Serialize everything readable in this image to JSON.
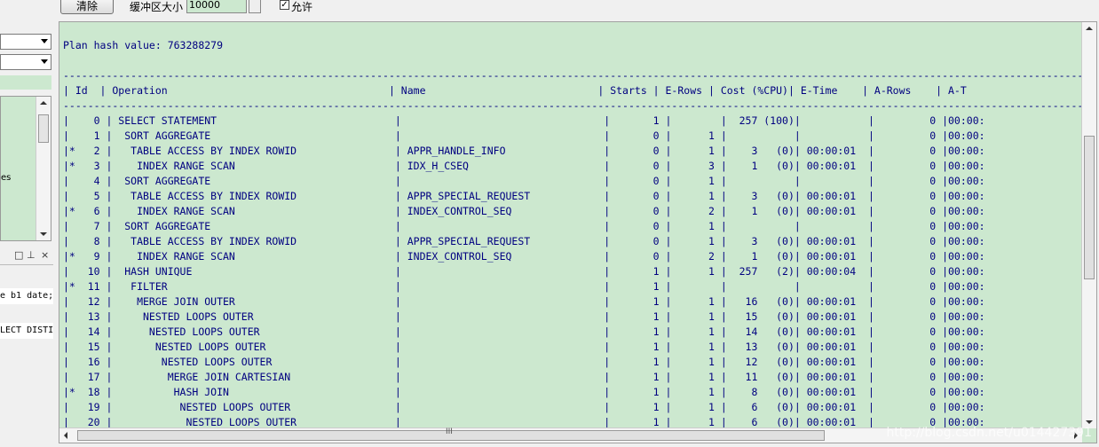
{
  "toolbar": {
    "clear_label": "清除",
    "buffer_label": "缓冲区大小",
    "buffer_value": "10000",
    "allow_checked": true,
    "allow_label": "允许"
  },
  "left_pane": {
    "tree_text": "es",
    "code_line_1": "e b1 date;",
    "code_line_2": "LECT DISTI"
  },
  "output": {
    "plan_header": "Plan hash value: 763288279",
    "columns": [
      "Id",
      "Operation",
      "Name",
      "Starts",
      "E-Rows",
      "Cost (%CPU)",
      "E-Time",
      "A-Rows",
      "A-T"
    ],
    "rows": [
      {
        "flag": "",
        "id": "0",
        "op": "SELECT STATEMENT",
        "name": "",
        "starts": "1",
        "erows": "",
        "cost": "257 (100)",
        "etime": "",
        "arows": "0",
        "atime": "00:00:"
      },
      {
        "flag": "",
        "id": "1",
        "op": " SORT AGGREGATE",
        "name": "",
        "starts": "0",
        "erows": "1",
        "cost": "",
        "etime": "",
        "arows": "0",
        "atime": "00:00:"
      },
      {
        "flag": "*",
        "id": "2",
        "op": "  TABLE ACCESS BY INDEX ROWID",
        "name": "APPR_HANDLE_INFO",
        "starts": "0",
        "erows": "1",
        "cost": "3   (0)",
        "etime": "00:00:01",
        "arows": "0",
        "atime": "00:00:"
      },
      {
        "flag": "*",
        "id": "3",
        "op": "   INDEX RANGE SCAN",
        "name": "IDX_H_CSEQ",
        "starts": "0",
        "erows": "3",
        "cost": "1   (0)",
        "etime": "00:00:01",
        "arows": "0",
        "atime": "00:00:"
      },
      {
        "flag": "",
        "id": "4",
        "op": " SORT AGGREGATE",
        "name": "",
        "starts": "0",
        "erows": "1",
        "cost": "",
        "etime": "",
        "arows": "0",
        "atime": "00:00:"
      },
      {
        "flag": "",
        "id": "5",
        "op": "  TABLE ACCESS BY INDEX ROWID",
        "name": "APPR_SPECIAL_REQUEST",
        "starts": "0",
        "erows": "1",
        "cost": "3   (0)",
        "etime": "00:00:01",
        "arows": "0",
        "atime": "00:00:"
      },
      {
        "flag": "*",
        "id": "6",
        "op": "   INDEX RANGE SCAN",
        "name": "INDEX_CONTROL_SEQ",
        "starts": "0",
        "erows": "2",
        "cost": "1   (0)",
        "etime": "00:00:01",
        "arows": "0",
        "atime": "00:00:"
      },
      {
        "flag": "",
        "id": "7",
        "op": " SORT AGGREGATE",
        "name": "",
        "starts": "0",
        "erows": "1",
        "cost": "",
        "etime": "",
        "arows": "0",
        "atime": "00:00:"
      },
      {
        "flag": "",
        "id": "8",
        "op": "  TABLE ACCESS BY INDEX ROWID",
        "name": "APPR_SPECIAL_REQUEST",
        "starts": "0",
        "erows": "1",
        "cost": "3   (0)",
        "etime": "00:00:01",
        "arows": "0",
        "atime": "00:00:"
      },
      {
        "flag": "*",
        "id": "9",
        "op": "   INDEX RANGE SCAN",
        "name": "INDEX_CONTROL_SEQ",
        "starts": "0",
        "erows": "2",
        "cost": "1   (0)",
        "etime": "00:00:01",
        "arows": "0",
        "atime": "00:00:"
      },
      {
        "flag": "",
        "id": "10",
        "op": " HASH UNIQUE",
        "name": "",
        "starts": "1",
        "erows": "1",
        "cost": "257   (2)",
        "etime": "00:00:04",
        "arows": "0",
        "atime": "00:00:"
      },
      {
        "flag": "*",
        "id": "11",
        "op": "  FILTER",
        "name": "",
        "starts": "1",
        "erows": "",
        "cost": "",
        "etime": "",
        "arows": "0",
        "atime": "00:00:"
      },
      {
        "flag": "",
        "id": "12",
        "op": "   MERGE JOIN OUTER",
        "name": "",
        "starts": "1",
        "erows": "1",
        "cost": "16   (0)",
        "etime": "00:00:01",
        "arows": "0",
        "atime": "00:00:"
      },
      {
        "flag": "",
        "id": "13",
        "op": "    NESTED LOOPS OUTER",
        "name": "",
        "starts": "1",
        "erows": "1",
        "cost": "15   (0)",
        "etime": "00:00:01",
        "arows": "0",
        "atime": "00:00:"
      },
      {
        "flag": "",
        "id": "14",
        "op": "     NESTED LOOPS OUTER",
        "name": "",
        "starts": "1",
        "erows": "1",
        "cost": "14   (0)",
        "etime": "00:00:01",
        "arows": "0",
        "atime": "00:00:"
      },
      {
        "flag": "",
        "id": "15",
        "op": "      NESTED LOOPS OUTER",
        "name": "",
        "starts": "1",
        "erows": "1",
        "cost": "13   (0)",
        "etime": "00:00:01",
        "arows": "0",
        "atime": "00:00:"
      },
      {
        "flag": "",
        "id": "16",
        "op": "       NESTED LOOPS OUTER",
        "name": "",
        "starts": "1",
        "erows": "1",
        "cost": "12   (0)",
        "etime": "00:00:01",
        "arows": "0",
        "atime": "00:00:"
      },
      {
        "flag": "",
        "id": "17",
        "op": "        MERGE JOIN CARTESIAN",
        "name": "",
        "starts": "1",
        "erows": "1",
        "cost": "11   (0)",
        "etime": "00:00:01",
        "arows": "0",
        "atime": "00:00:"
      },
      {
        "flag": "*",
        "id": "18",
        "op": "         HASH JOIN",
        "name": "",
        "starts": "1",
        "erows": "1",
        "cost": "8   (0)",
        "etime": "00:00:01",
        "arows": "0",
        "atime": "00:00:"
      },
      {
        "flag": "",
        "id": "19",
        "op": "          NESTED LOOPS OUTER",
        "name": "",
        "starts": "1",
        "erows": "1",
        "cost": "6   (0)",
        "etime": "00:00:01",
        "arows": "0",
        "atime": "00:00:"
      },
      {
        "flag": "",
        "id": "20",
        "op": "           NESTED LOOPS OUTER",
        "name": "",
        "starts": "1",
        "erows": "1",
        "cost": "6   (0)",
        "etime": "00:00:01",
        "arows": "0",
        "atime": "00:00:"
      }
    ]
  },
  "scroll": {
    "h_grip": "III"
  },
  "watermark": "http://blog.csdn.net/u014427391"
}
